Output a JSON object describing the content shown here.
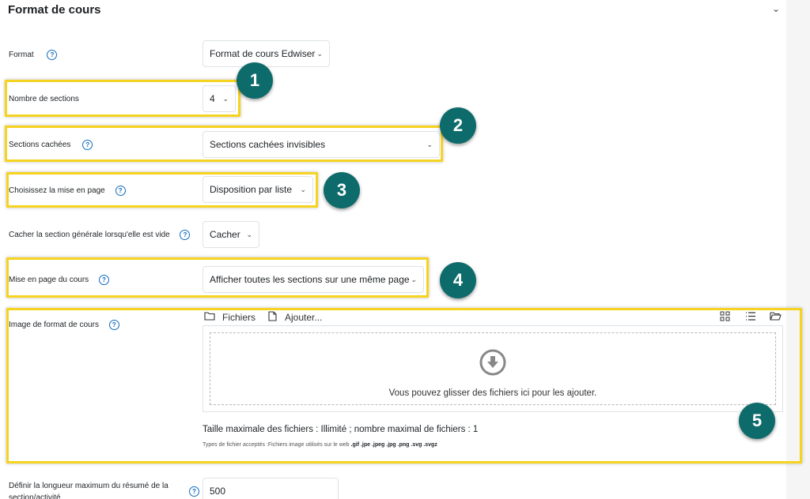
{
  "section": {
    "title": "Format de cours"
  },
  "fields": {
    "format": {
      "label": "Format",
      "value": "Format de cours Edwiser"
    },
    "sections": {
      "label": "Nombre de sections",
      "value": "4"
    },
    "hidden": {
      "label": "Sections cachées",
      "value": "Sections cachées invisibles"
    },
    "layout": {
      "label": "Choisissez la mise en page",
      "value": "Disposition par liste"
    },
    "hidegeneral": {
      "label": "Cacher la section générale lorsqu'elle est vide",
      "value": "Cacher"
    },
    "courselayout": {
      "label": "Mise en page du cours",
      "value": "Afficher toutes les sections sur une même page"
    },
    "image": {
      "label": "Image de format de cours"
    },
    "summary": {
      "label_line1": "Définir la longueur maximum du résumé de la",
      "label_line2": "section/activité",
      "value": "500"
    }
  },
  "filepicker": {
    "files_label": "Fichiers",
    "add_label": "Ajouter...",
    "drop_text": "Vous pouvez glisser des fichiers ici pour les ajouter.",
    "max_text": "Taille maximale des fichiers : Illimité ; nombre maximal de fichiers : 1",
    "types_prefix": "Types de fichier acceptés :Fichiers image utilisés sur le web",
    "types_list": ".gif .jpe .jpeg .jpg .png .svg .svgz"
  },
  "badges": [
    "1",
    "2",
    "3",
    "4",
    "5"
  ],
  "help_glyph": "?",
  "colors": {
    "highlight": "#f6d320",
    "badge": "#0e6b6b",
    "help": "#0f6cbf"
  }
}
